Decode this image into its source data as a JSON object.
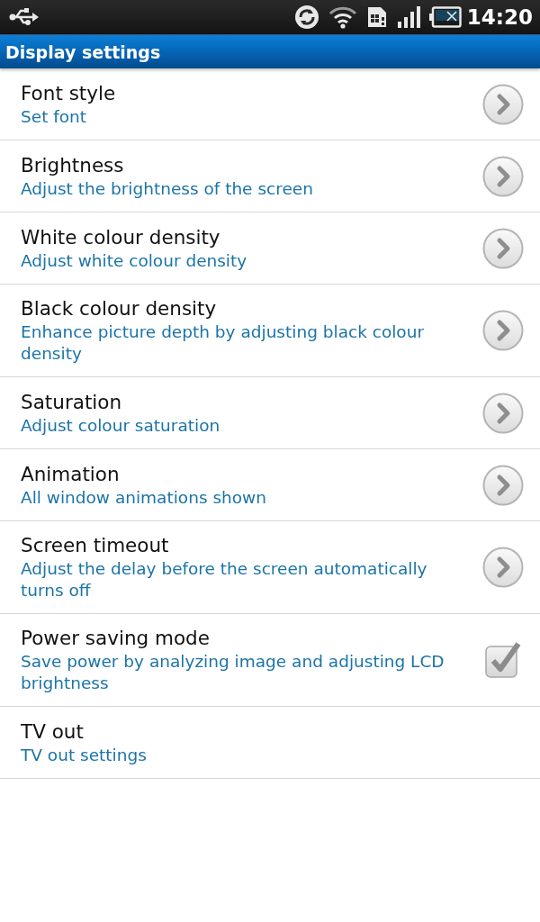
{
  "status_bar": {
    "time": "14:20"
  },
  "title_bar": {
    "title": "Display settings"
  },
  "settings": [
    {
      "title": "Font style",
      "summary": "Set font",
      "kind": "chevron"
    },
    {
      "title": "Brightness",
      "summary": "Adjust the brightness of the screen",
      "kind": "chevron"
    },
    {
      "title": "White colour density",
      "summary": "Adjust white colour density",
      "kind": "chevron"
    },
    {
      "title": "Black colour density",
      "summary": "Enhance picture depth by adjusting black colour density",
      "kind": "chevron"
    },
    {
      "title": "Saturation",
      "summary": "Adjust colour saturation",
      "kind": "chevron"
    },
    {
      "title": "Animation",
      "summary": "All window animations shown",
      "kind": "chevron"
    },
    {
      "title": "Screen timeout",
      "summary": "Adjust the delay before the screen automatically turns off",
      "kind": "chevron"
    },
    {
      "title": "Power saving mode",
      "summary": "Save power by analyzing image and adjusting LCD brightness",
      "kind": "checkbox",
      "checked": true
    },
    {
      "title": "TV out",
      "summary": "TV out settings",
      "kind": "plain"
    }
  ]
}
